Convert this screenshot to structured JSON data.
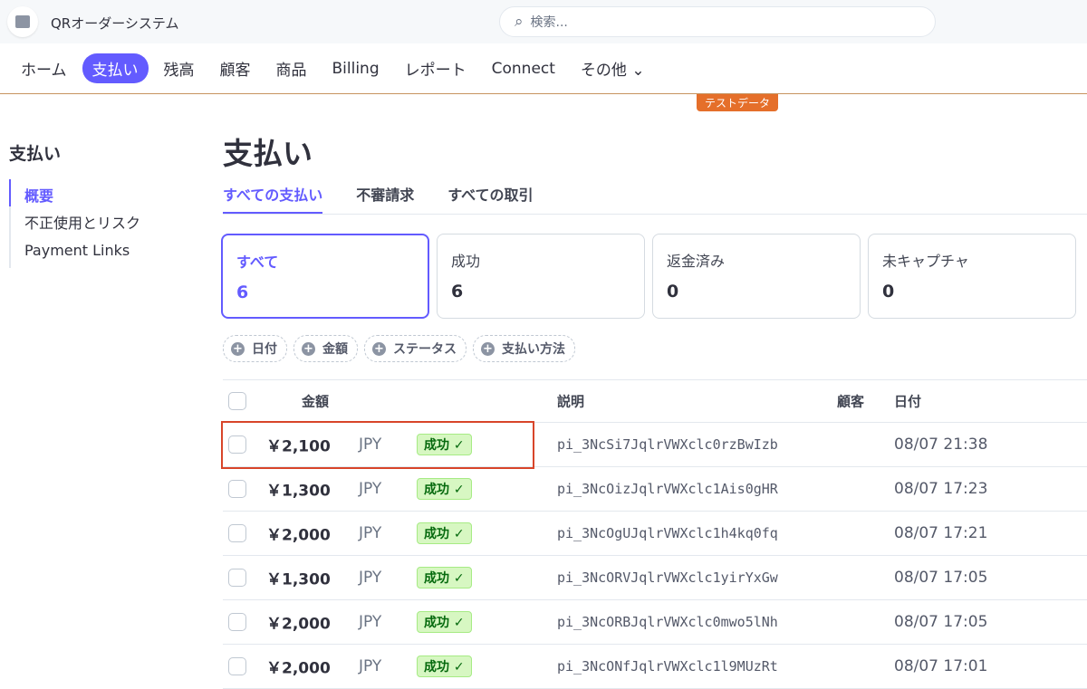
{
  "app": {
    "name": "QRオーダーシステム",
    "search_placeholder": "検索..."
  },
  "nav": {
    "items": [
      "ホーム",
      "支払い",
      "残高",
      "顧客",
      "商品",
      "Billing",
      "レポート",
      "Connect",
      "その他"
    ],
    "active": "支払い",
    "more_chevron": "chevron-down-icon"
  },
  "test_badge": "テストデータ",
  "sidebar": {
    "title": "支払い",
    "items": [
      "概要",
      "不正使用とリスク",
      "Payment Links"
    ]
  },
  "page": {
    "title": "支払い",
    "tabs": [
      "すべての支払い",
      "不審請求",
      "すべての取引"
    ]
  },
  "cards": [
    {
      "label": "すべて",
      "value": "6"
    },
    {
      "label": "成功",
      "value": "6"
    },
    {
      "label": "返金済み",
      "value": "0"
    },
    {
      "label": "未キャプチャ",
      "value": "0"
    }
  ],
  "filters": [
    "日付",
    "金額",
    "ステータス",
    "支払い方法"
  ],
  "table": {
    "headers": {
      "amount": "金額",
      "description": "説明",
      "customer": "顧客",
      "date": "日付"
    },
    "rows": [
      {
        "amount": "￥2,100",
        "currency": "JPY",
        "status": "成功 ✓",
        "description": "pi_3NcSi7JqlrVWXclc0rzBwIzb",
        "date": "08/07 21:38"
      },
      {
        "amount": "￥1,300",
        "currency": "JPY",
        "status": "成功 ✓",
        "description": "pi_3NcOizJqlrVWXclc1Ais0gHR",
        "date": "08/07 17:23"
      },
      {
        "amount": "￥2,000",
        "currency": "JPY",
        "status": "成功 ✓",
        "description": "pi_3NcOgUJqlrVWXclc1h4kq0fq",
        "date": "08/07 17:21"
      },
      {
        "amount": "￥1,300",
        "currency": "JPY",
        "status": "成功 ✓",
        "description": "pi_3NcORVJqlrVWXclc1yirYxGw",
        "date": "08/07 17:05"
      },
      {
        "amount": "￥2,000",
        "currency": "JPY",
        "status": "成功 ✓",
        "description": "pi_3NcORBJqlrVWXclc0mwo5lNh",
        "date": "08/07 17:05"
      },
      {
        "amount": "￥2,000",
        "currency": "JPY",
        "status": "成功 ✓",
        "description": "pi_3NcONfJqlrVWXclc1l9MUzRt",
        "date": "08/07 17:01"
      }
    ]
  },
  "colors": {
    "accent": "#635bff",
    "highlight": "#d8452a",
    "test_badge": "#e56f2a"
  }
}
